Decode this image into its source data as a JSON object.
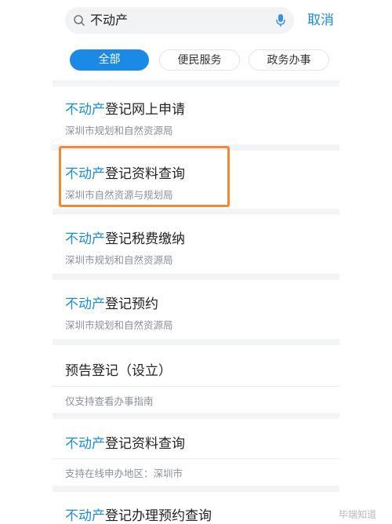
{
  "search": {
    "query": "不动产"
  },
  "cancel_label": "取消",
  "tabs": [
    {
      "label": "全部",
      "active": true
    },
    {
      "label": "便民服务",
      "active": false
    },
    {
      "label": "政务办事",
      "active": false
    }
  ],
  "results": [
    {
      "highlight": "不动产",
      "rest": "登记网上申请",
      "subtitle": "深圳市规划和自然资源局"
    },
    {
      "highlight": "不动产",
      "rest": "登记资料查询",
      "subtitle": "深圳市自然资源与规划局"
    },
    {
      "highlight": "不动产",
      "rest": "登记税费缴纳",
      "subtitle": "深圳市规划和自然资源局"
    },
    {
      "highlight": "不动产",
      "rest": "登记预约",
      "subtitle": "深圳市规划和自然资源局"
    },
    {
      "highlight": "",
      "rest": "预告登记（设立）",
      "subtitle": "仅支持查看办事指南"
    },
    {
      "highlight": "不动产",
      "rest": "登记资料查询",
      "subtitle": "支持在线申办地区：深圳市"
    },
    {
      "highlight": "不动产",
      "rest": "登记办理预约查询",
      "subtitle": ""
    }
  ],
  "watermark": "毕端知道",
  "colors": {
    "accent": "#1a8cd8",
    "highlight_box": "#f0883a"
  }
}
